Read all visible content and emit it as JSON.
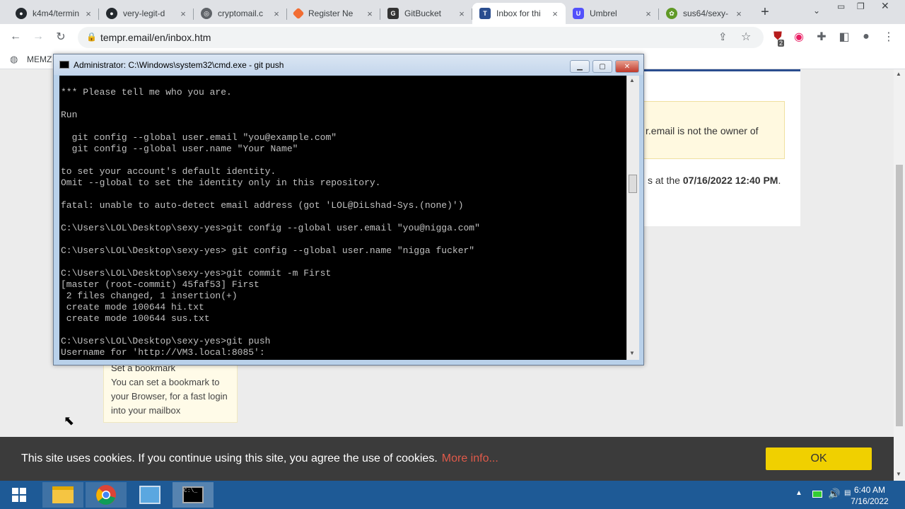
{
  "tabs": [
    {
      "title": "k4m4/termin",
      "icon": "github-icon",
      "close": "×"
    },
    {
      "title": "very-legit-d",
      "icon": "github-icon",
      "close": "×"
    },
    {
      "title": "cryptomail.c",
      "icon": "globe-icon",
      "close": "×"
    },
    {
      "title": "Register Ne",
      "icon": "gitea-icon",
      "close": "×"
    },
    {
      "title": "GitBucket",
      "icon": "gitbucket-icon",
      "close": "×"
    },
    {
      "title": "Inbox for thi",
      "icon": "tempr-icon",
      "close": "×"
    },
    {
      "title": "Umbrel",
      "icon": "umbrel-icon",
      "close": "×"
    },
    {
      "title": "sus64/sexy-",
      "icon": "gogs-icon",
      "close": "×"
    }
  ],
  "new_tab": "+",
  "address": "tempr.email/en/inbox.htm",
  "bookmark_label": "MEMZ",
  "extension_badge": "2",
  "page": {
    "notice_text": "r.email is not the owner of",
    "date_prefix": "s at the ",
    "date_value": "07/16/2022 12:40 PM",
    "date_suffix": ".",
    "bookmark_title": "Set a bookmark",
    "bookmark_body": "You can set a bookmark to your Browser, for a fast login into your mailbox"
  },
  "cmd": {
    "title": "Administrator: C:\\Windows\\system32\\cmd.exe - git  push",
    "lines": [
      "*** Please tell me who you are.",
      "",
      "Run",
      "",
      "  git config --global user.email \"you@example.com\"",
      "  git config --global user.name \"Your Name\"",
      "",
      "to set your account's default identity.",
      "Omit --global to set the identity only in this repository.",
      "",
      "fatal: unable to auto-detect email address (got 'LOL@DiLshad-Sys.(none)')",
      "",
      "C:\\Users\\LOL\\Desktop\\sexy-yes>git config --global user.email \"you@nigga.com\"",
      "",
      "C:\\Users\\LOL\\Desktop\\sexy-yes> git config --global user.name \"nigga fucker\"",
      "",
      "C:\\Users\\LOL\\Desktop\\sexy-yes>git commit -m First",
      "[master (root-commit) 45faf53] First",
      " 2 files changed, 1 insertion(+)",
      " create mode 100644 hi.txt",
      " create mode 100644 sus.txt",
      "",
      "C:\\Users\\LOL\\Desktop\\sexy-yes>git push",
      "Username for 'http://VM3.local:8085':"
    ]
  },
  "cookie": {
    "text": "This site uses cookies. If you continue using this site, you agree the use of cookies.",
    "link": "More info...",
    "ok": "OK"
  },
  "taskbar": {
    "time": "6:40 AM",
    "date": "7/16/2022"
  },
  "colors": {
    "accent_yellow": "#f0d000",
    "link_red": "#e05a4a",
    "taskbar": "#1e5a96"
  }
}
